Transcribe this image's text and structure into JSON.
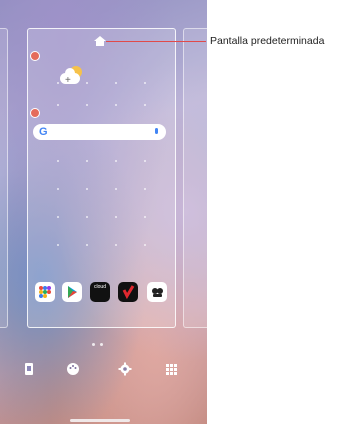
{
  "callout": {
    "label": "Pantalla predeterminada"
  },
  "home_screen": {
    "search_bar": {
      "logo": "G"
    },
    "apps": [
      {
        "name": "folder-apps-icon"
      },
      {
        "name": "play-store-icon"
      },
      {
        "name": "cloud-icon",
        "text": "cloud"
      },
      {
        "name": "verizon-icon"
      },
      {
        "name": "messages-icon"
      }
    ]
  },
  "dock": {
    "items": [
      "widgets-icon",
      "palette-icon",
      "gear-icon",
      "grid-apps-icon"
    ]
  },
  "colors": {
    "callout_line": "#e04a4a",
    "remove_dot": "#e46b5b"
  }
}
